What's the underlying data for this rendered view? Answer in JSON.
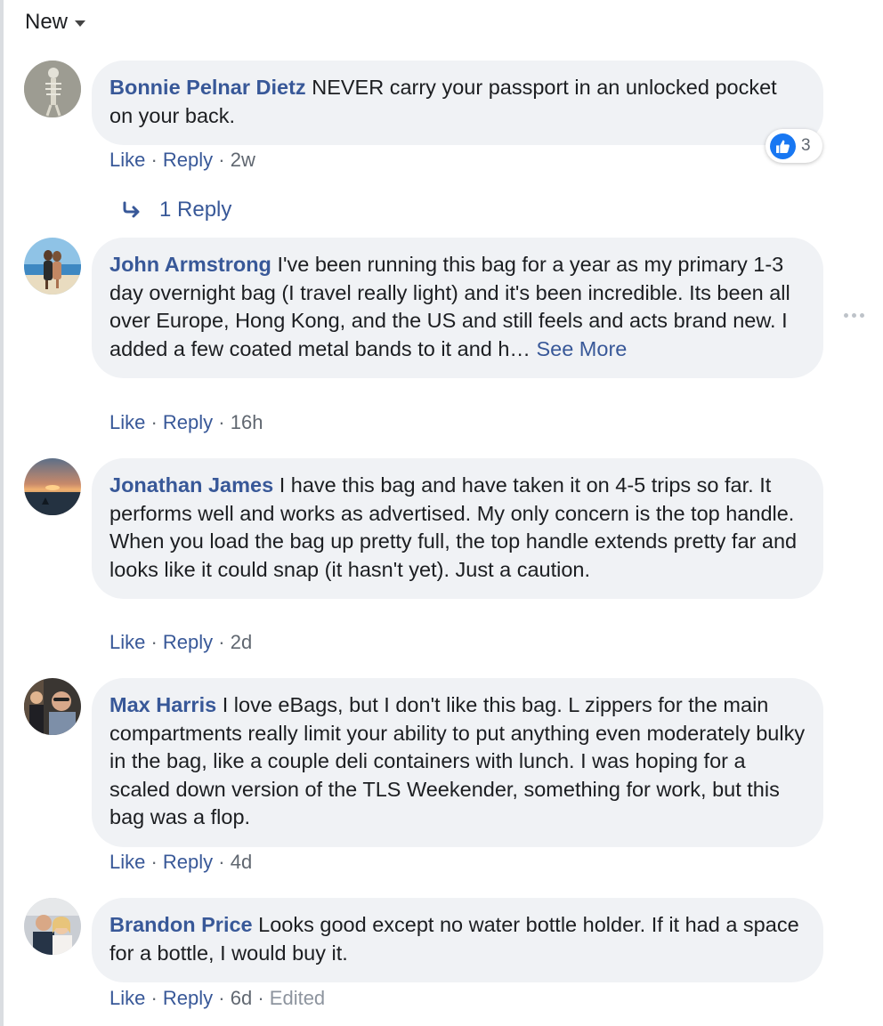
{
  "sort": {
    "label": "New"
  },
  "comments": [
    {
      "author": "Bonnie Pelnar Dietz",
      "text": "NEVER carry your passport in an unlocked pocket on your back.",
      "like": "Like",
      "reply": "Reply",
      "time": "2w",
      "reactions": {
        "icon": "like-icon",
        "count": "3"
      }
    },
    {
      "author": "John Armstrong",
      "text": "I've been running this bag for a year as my primary 1-3 day overnight bag (I travel really light) and it's been incredible. Its been all over Europe, Hong Kong, and the US and still feels and acts brand new. I added a few coated metal bands to it and h…",
      "see_more": "See More",
      "like": "Like",
      "reply": "Reply",
      "time": "16h"
    },
    {
      "author": "Jonathan James",
      "text": "I have this bag and have taken it on 4-5 trips so far. It performs well and works as advertised. My only concern is the top handle. When you load the bag up pretty full, the top handle extends pretty far and looks like it could snap (it hasn't yet). Just a caution.",
      "like": "Like",
      "reply": "Reply",
      "time": "2d"
    },
    {
      "author": "Max Harris",
      "text": "I love eBags, but I don't like this bag. L zippers for the main compartments really limit your ability to put anything even moderately bulky in the bag, like a couple deli containers with lunch. I was hoping for a scaled down version of the TLS Weekender, something for work, but this bag was a flop.",
      "like": "Like",
      "reply": "Reply",
      "time": "4d"
    },
    {
      "author": "Brandon Price",
      "text": "Looks good except no water bottle holder. If it had a space for a bottle, I would buy it.",
      "like": "Like",
      "reply": "Reply",
      "time": "6d",
      "edited": "Edited"
    }
  ],
  "replies_link": {
    "label": "1 Reply",
    "icon": "reply-arrow-icon"
  },
  "colors": {
    "link": "#385898",
    "bubble": "#f0f2f5",
    "meta": "#606770",
    "like_blue": "#1877f2"
  }
}
